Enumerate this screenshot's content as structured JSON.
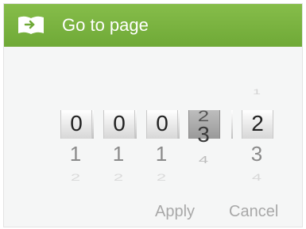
{
  "dialog": {
    "title": "Go to page",
    "icon": "book-icon",
    "accent_color": "#78b33f"
  },
  "picker": {
    "wheels": [
      {
        "above": [],
        "selected": "0",
        "below": [
          "1",
          "2"
        ]
      },
      {
        "above": [],
        "selected": "0",
        "below": [
          "1",
          "2"
        ]
      },
      {
        "above": [],
        "selected": "0",
        "below": [
          "1",
          "2"
        ]
      },
      {
        "above": [
          "2"
        ],
        "selected": "3",
        "below": [
          "4"
        ]
      },
      {
        "above": [
          "1"
        ],
        "selected": "2",
        "below": [
          "3",
          "4"
        ]
      }
    ]
  },
  "buttons": {
    "apply_label": "Apply",
    "cancel_label": "Cancel"
  }
}
